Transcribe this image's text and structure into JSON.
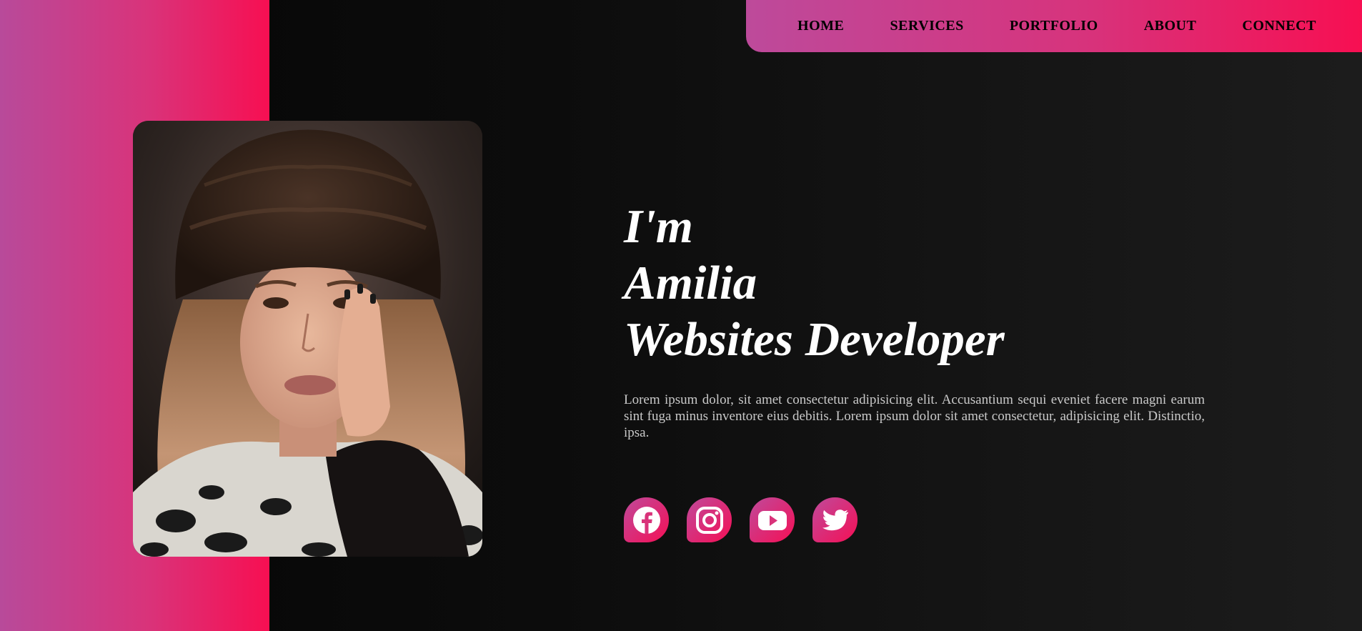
{
  "nav": {
    "items": [
      {
        "label": "HOME"
      },
      {
        "label": "SERVICES"
      },
      {
        "label": "PORTFOLIO"
      },
      {
        "label": "ABOUT"
      },
      {
        "label": "CONNECT"
      }
    ]
  },
  "hero": {
    "line1": "I'm",
    "line2": "Amilia",
    "line3": "Websites Developer",
    "description": "Lorem ipsum dolor, sit amet consectetur adipisicing elit. Accusantium sequi eveniet facere magni earum sint fuga minus inventore eius debitis. Lorem ipsum dolor sit amet consectetur, adipisicing elit. Distinctio, ipsa."
  },
  "socials": [
    {
      "icon": "facebook-icon"
    },
    {
      "icon": "instagram-icon"
    },
    {
      "icon": "youtube-icon"
    },
    {
      "icon": "twitter-icon"
    }
  ],
  "colors": {
    "accent_start": "#bd4a9b",
    "accent_end": "#f70f52",
    "background": "#0c0c0c",
    "text": "#ffffff"
  }
}
